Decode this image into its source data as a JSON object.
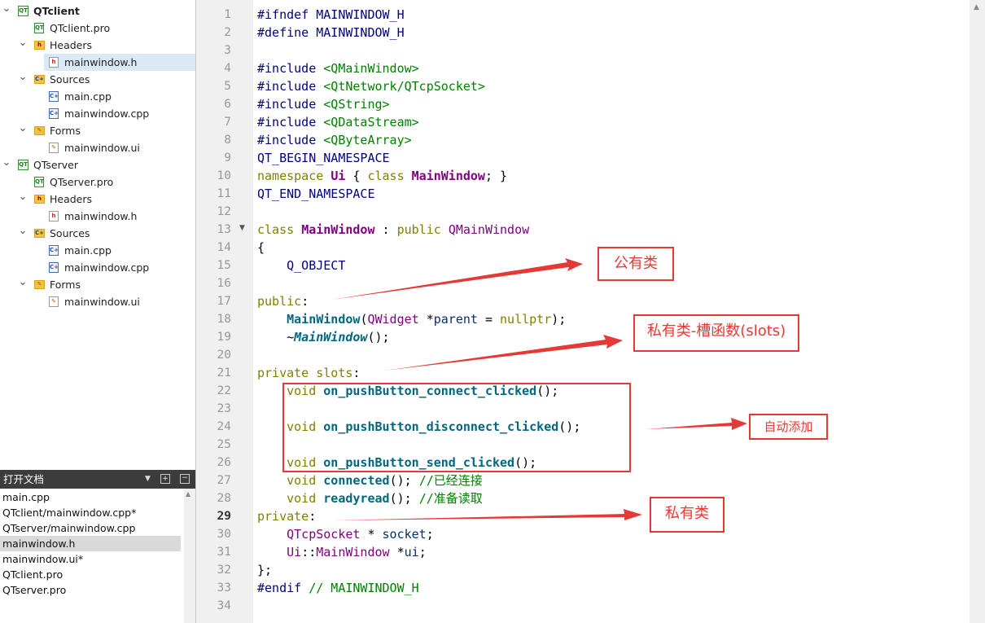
{
  "project_tree": [
    {
      "label": "QTclient",
      "kind": "project",
      "bold": true,
      "expanded": true,
      "depth": 0
    },
    {
      "label": "QTclient.pro",
      "kind": "pro",
      "depth": 1
    },
    {
      "label": "Headers",
      "kind": "folder-h",
      "expanded": true,
      "depth": 1
    },
    {
      "label": "mainwindow.h",
      "kind": "h",
      "depth": 2,
      "selected": true
    },
    {
      "label": "Sources",
      "kind": "folder-src",
      "expanded": true,
      "depth": 1
    },
    {
      "label": "main.cpp",
      "kind": "cpp",
      "depth": 2
    },
    {
      "label": "mainwindow.cpp",
      "kind": "cpp",
      "depth": 2
    },
    {
      "label": "Forms",
      "kind": "folder-ui",
      "expanded": true,
      "depth": 1
    },
    {
      "label": "mainwindow.ui",
      "kind": "ui",
      "depth": 2
    },
    {
      "label": "QTserver",
      "kind": "project",
      "expanded": true,
      "depth": 0
    },
    {
      "label": "QTserver.pro",
      "kind": "pro",
      "depth": 1
    },
    {
      "label": "Headers",
      "kind": "folder-h",
      "expanded": true,
      "depth": 1
    },
    {
      "label": "mainwindow.h",
      "kind": "h",
      "depth": 2
    },
    {
      "label": "Sources",
      "kind": "folder-src",
      "expanded": true,
      "depth": 1
    },
    {
      "label": "main.cpp",
      "kind": "cpp",
      "depth": 2
    },
    {
      "label": "mainwindow.cpp",
      "kind": "cpp",
      "depth": 2
    },
    {
      "label": "Forms",
      "kind": "folder-ui",
      "expanded": true,
      "depth": 1
    },
    {
      "label": "mainwindow.ui",
      "kind": "ui",
      "depth": 2
    }
  ],
  "open_documents": {
    "title": "打开文档",
    "items": [
      {
        "label": "main.cpp"
      },
      {
        "label": "QTclient/mainwindow.cpp*"
      },
      {
        "label": "QTserver/mainwindow.cpp"
      },
      {
        "label": "mainwindow.h",
        "selected": true
      },
      {
        "label": "mainwindow.ui*"
      },
      {
        "label": "QTclient.pro"
      },
      {
        "label": "QTserver.pro"
      }
    ]
  },
  "editor": {
    "current_line": 29,
    "lines": [
      [
        [
          "#ifndef MAINWINDOW_H",
          "pre"
        ]
      ],
      [
        [
          "#define MAINWINDOW_H",
          "pre"
        ]
      ],
      [],
      [
        [
          "#include ",
          "pre"
        ],
        [
          "<QMainWindow>",
          "inc"
        ]
      ],
      [
        [
          "#include ",
          "pre"
        ],
        [
          "<QtNetwork/QTcpSocket>",
          "inc"
        ]
      ],
      [
        [
          "#include ",
          "pre"
        ],
        [
          "<QString>",
          "inc"
        ]
      ],
      [
        [
          "#include ",
          "pre"
        ],
        [
          "<QDataStream>",
          "inc"
        ]
      ],
      [
        [
          "#include ",
          "pre"
        ],
        [
          "<QByteArray>",
          "inc"
        ]
      ],
      [
        [
          "QT_BEGIN_NAMESPACE",
          "mac"
        ]
      ],
      [
        [
          "namespace ",
          "kw"
        ],
        [
          "Ui",
          "cls"
        ],
        [
          " { ",
          ""
        ],
        [
          "class ",
          "kw"
        ],
        [
          "MainWindow",
          "cls"
        ],
        [
          "; }",
          ""
        ]
      ],
      [
        [
          "QT_END_NAMESPACE",
          "mac"
        ]
      ],
      [],
      [
        [
          "class ",
          "kw"
        ],
        [
          "MainWindow",
          "cls"
        ],
        [
          " : ",
          ""
        ],
        [
          "public ",
          "kw"
        ],
        [
          "QMainWindow",
          "typ"
        ]
      ],
      [
        [
          "{",
          ""
        ]
      ],
      [
        [
          "    Q_OBJECT",
          "mac"
        ]
      ],
      [],
      [
        [
          "public",
          "kw"
        ],
        [
          ":",
          ""
        ]
      ],
      [
        [
          "    ",
          ""
        ],
        [
          "MainWindow",
          "fn"
        ],
        [
          "(",
          ""
        ],
        [
          "QWidget",
          "typ"
        ],
        [
          " *",
          ""
        ],
        [
          "parent",
          "id"
        ],
        [
          " = ",
          ""
        ],
        [
          "nullptr",
          "kw"
        ],
        [
          ");",
          ""
        ]
      ],
      [
        [
          "    ~",
          ""
        ],
        [
          "MainWindow",
          "fni"
        ],
        [
          "();",
          ""
        ]
      ],
      [],
      [
        [
          "private slots",
          "kw"
        ],
        [
          ":",
          ""
        ]
      ],
      [
        [
          "    ",
          ""
        ],
        [
          "void ",
          "kw"
        ],
        [
          "on_pushButton_connect_clicked",
          "fn"
        ],
        [
          "();",
          ""
        ]
      ],
      [],
      [
        [
          "    ",
          ""
        ],
        [
          "void ",
          "kw"
        ],
        [
          "on_pushButton_disconnect_clicked",
          "fn"
        ],
        [
          "();",
          ""
        ]
      ],
      [],
      [
        [
          "    ",
          ""
        ],
        [
          "void ",
          "kw"
        ],
        [
          "on_pushButton_send_clicked",
          "fn"
        ],
        [
          "();",
          ""
        ]
      ],
      [
        [
          "    ",
          ""
        ],
        [
          "void ",
          "kw"
        ],
        [
          "connected",
          "fn"
        ],
        [
          "(); ",
          ""
        ],
        [
          "//已经连接",
          "cm"
        ]
      ],
      [
        [
          "    ",
          ""
        ],
        [
          "void ",
          "kw"
        ],
        [
          "readyread",
          "fn"
        ],
        [
          "(); ",
          ""
        ],
        [
          "//准备读取",
          "cm"
        ]
      ],
      [
        [
          "private",
          "kw"
        ],
        [
          ":",
          ""
        ]
      ],
      [
        [
          "    ",
          ""
        ],
        [
          "QTcpSocket",
          "typ"
        ],
        [
          " * ",
          ""
        ],
        [
          "socket",
          "id"
        ],
        [
          ";",
          ""
        ]
      ],
      [
        [
          "    ",
          ""
        ],
        [
          "Ui",
          "typ"
        ],
        [
          "::",
          ""
        ],
        [
          "MainWindow",
          "typ"
        ],
        [
          " *",
          ""
        ],
        [
          "ui",
          "id"
        ],
        [
          ";",
          ""
        ]
      ],
      [
        [
          "};",
          ""
        ]
      ],
      [
        [
          "#endif ",
          "pre"
        ],
        [
          "// MAINWINDOW_H",
          "cm"
        ]
      ],
      []
    ]
  },
  "annotations": {
    "public_class": "公有类",
    "private_slots": "私有类-槽函数(slots)",
    "auto_added": "自动添加",
    "private_class": "私有类"
  },
  "colors": {
    "annotation_red": "#e53935"
  }
}
